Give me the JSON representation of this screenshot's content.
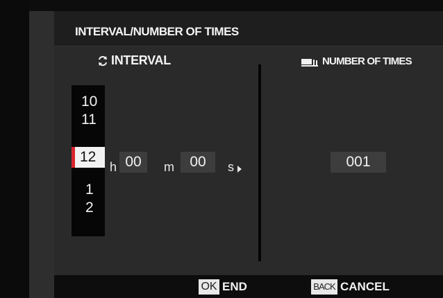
{
  "title": "INTERVAL/NUMBER OF TIMES",
  "interval": {
    "header": "INTERVAL",
    "hours_options": [
      "10",
      "11",
      "12",
      "1",
      "2"
    ],
    "hours_selected": "12",
    "hour_unit": "h",
    "minutes": "00",
    "minute_unit": "m",
    "seconds": "00",
    "second_unit": "s"
  },
  "number_of_times": {
    "header": "NUMBER OF TIMES",
    "value": "001"
  },
  "footer": {
    "ok_badge": "OK",
    "ok_label": "END",
    "back_badge": "BACK",
    "back_label": "CANCEL"
  },
  "colors": {
    "selection_accent": "#d9242e",
    "panel_bg": "#2a2a2a"
  },
  "icons": {
    "interval": "repeat-cycle-icon",
    "number_of_times": "stacked-frames-icon",
    "back": "triangle-left-icon",
    "next": "triangle-right-icon"
  }
}
